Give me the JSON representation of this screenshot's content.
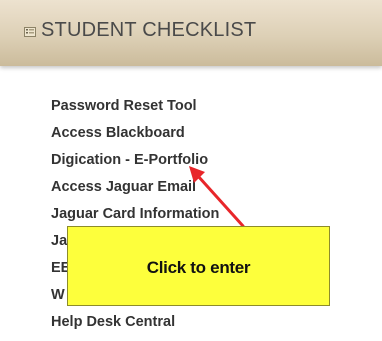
{
  "header": {
    "title": "STUDENT CHECKLIST",
    "icon": "checklist-icon"
  },
  "links": [
    {
      "label": "Password Reset Tool"
    },
    {
      "label": "Access Blackboard"
    },
    {
      "label": "Digication - E-Portfolio"
    },
    {
      "label": "Access Jaguar Email"
    },
    {
      "label": "Jaguar Card Information"
    },
    {
      "label": "Ja"
    },
    {
      "label": "EE"
    },
    {
      "label": "W"
    },
    {
      "label": "Help Desk Central"
    }
  ],
  "callout": {
    "text": "Click to enter",
    "background": "#fdff3c"
  },
  "annotation": {
    "arrow_color": "#e8262a"
  }
}
